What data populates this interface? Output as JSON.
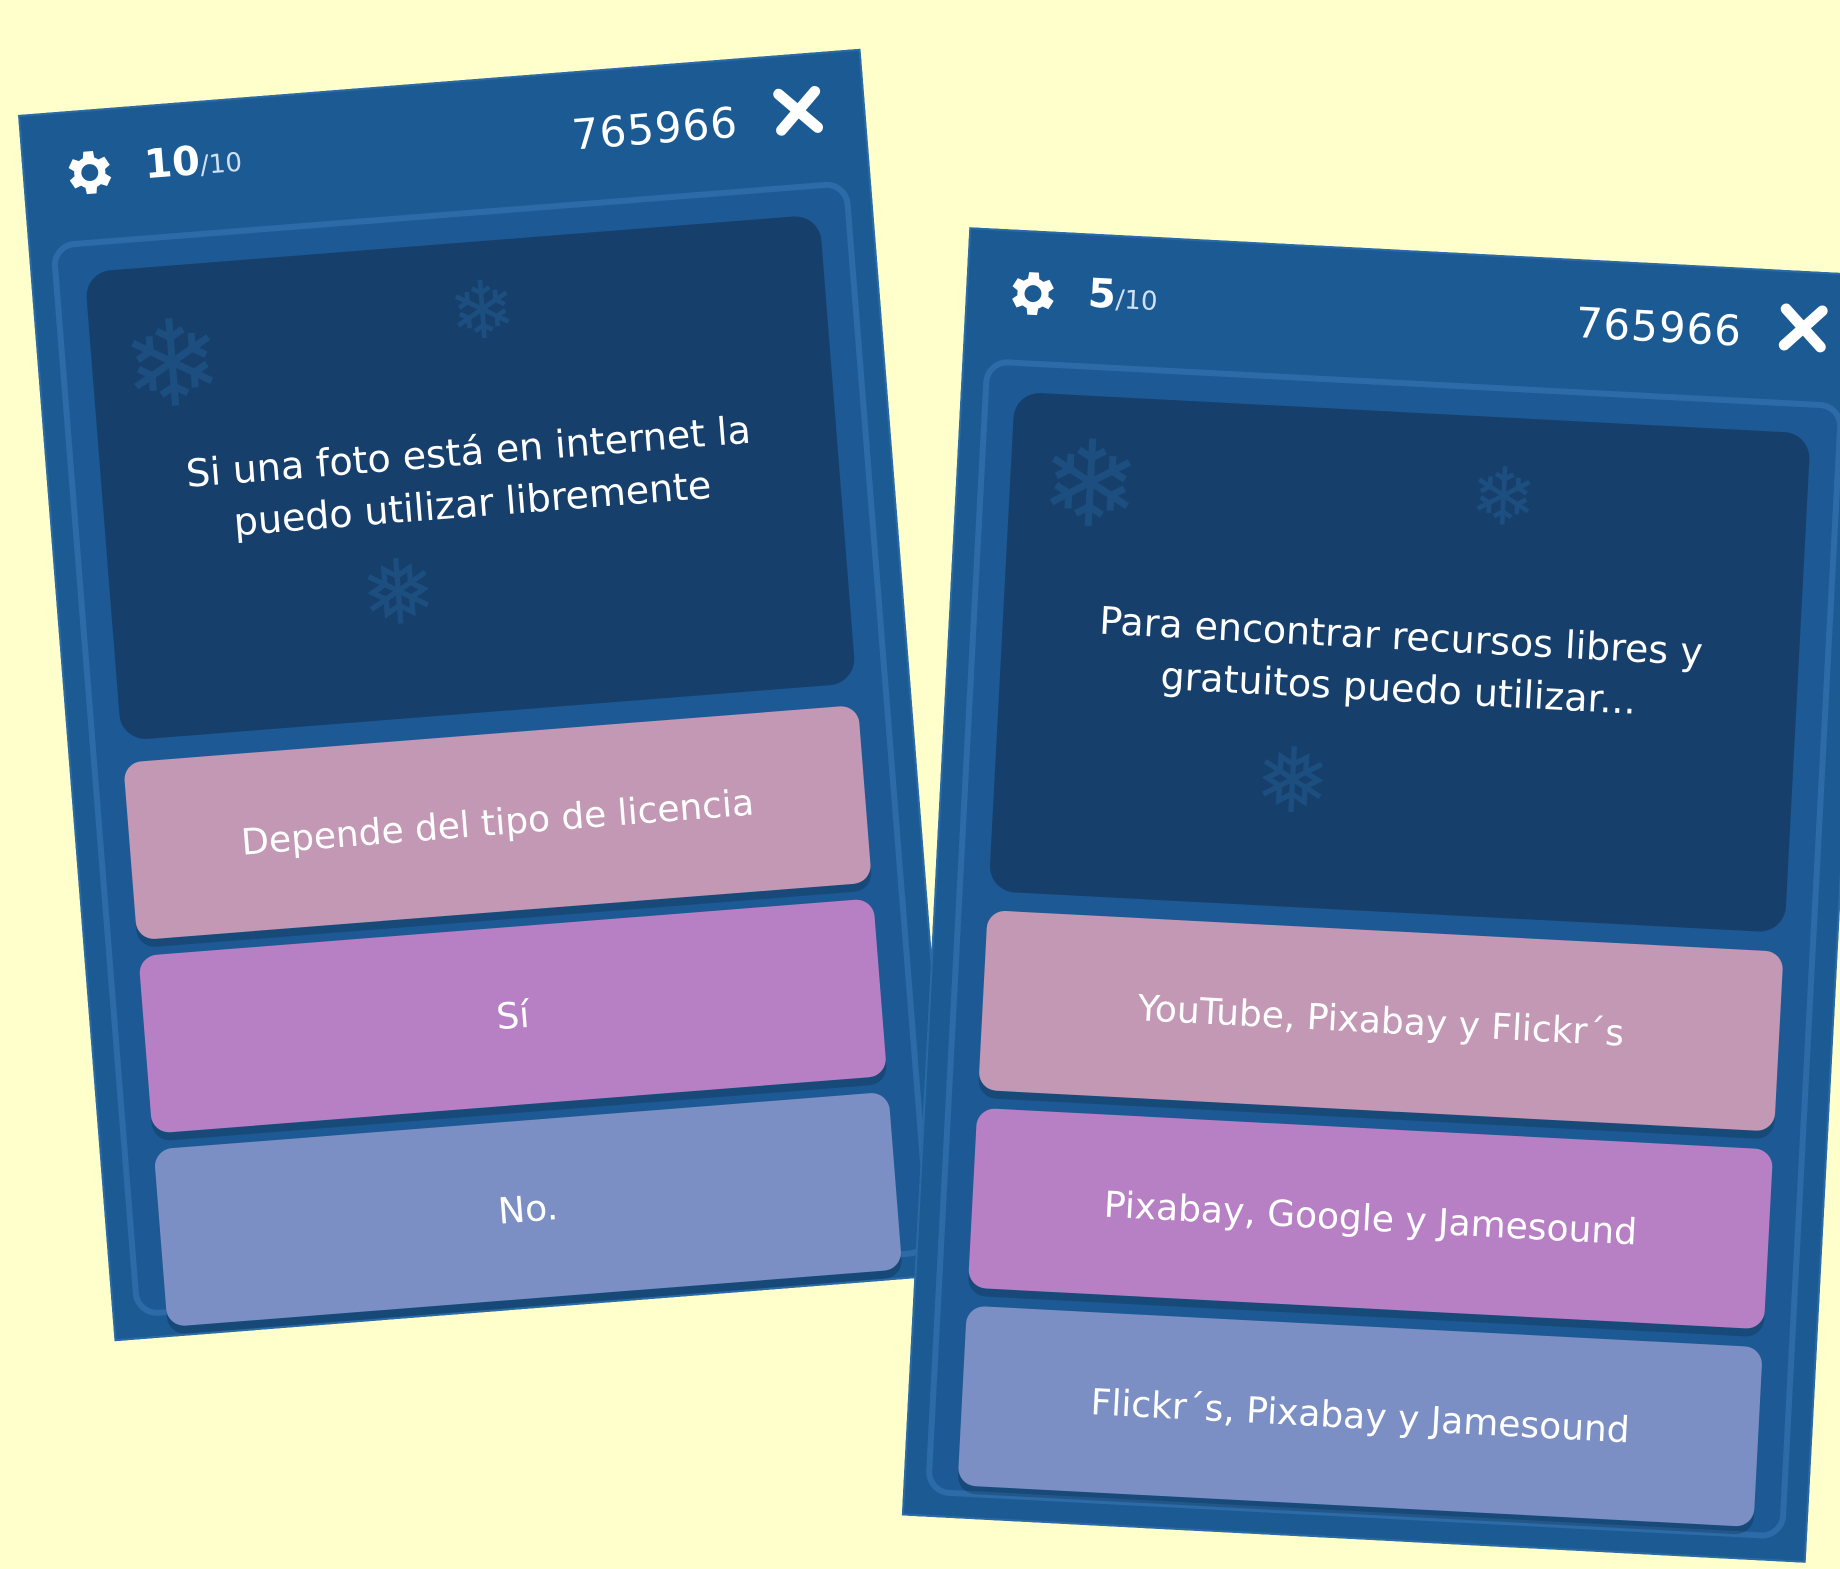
{
  "cards": [
    {
      "counter": {
        "current": "10",
        "total": "/10"
      },
      "score": "765966",
      "question": "Si una foto está en internet la puedo utilizar libremente",
      "answers": [
        "Depende del tipo de licencia",
        "Sí",
        "No."
      ]
    },
    {
      "counter": {
        "current": "5",
        "total": "/10"
      },
      "score": "765966",
      "question": "Para encontrar recursos libres y gratuitos puedo utilizar...",
      "answers": [
        "YouTube, Pixabay y Flickr´s",
        "Pixabay, Google y Jamesound",
        "Flickr´s, Pixabay y Jamesound"
      ]
    }
  ],
  "icons": {
    "settings": "gear-icon",
    "close": "close-icon"
  },
  "colors": {
    "background": "#ffffcc",
    "card": "#1b5a93",
    "question_panel": "#163f6c",
    "answer_1": "#c298b4",
    "answer_2": "#b880c4",
    "answer_3": "#7b8fc4"
  }
}
